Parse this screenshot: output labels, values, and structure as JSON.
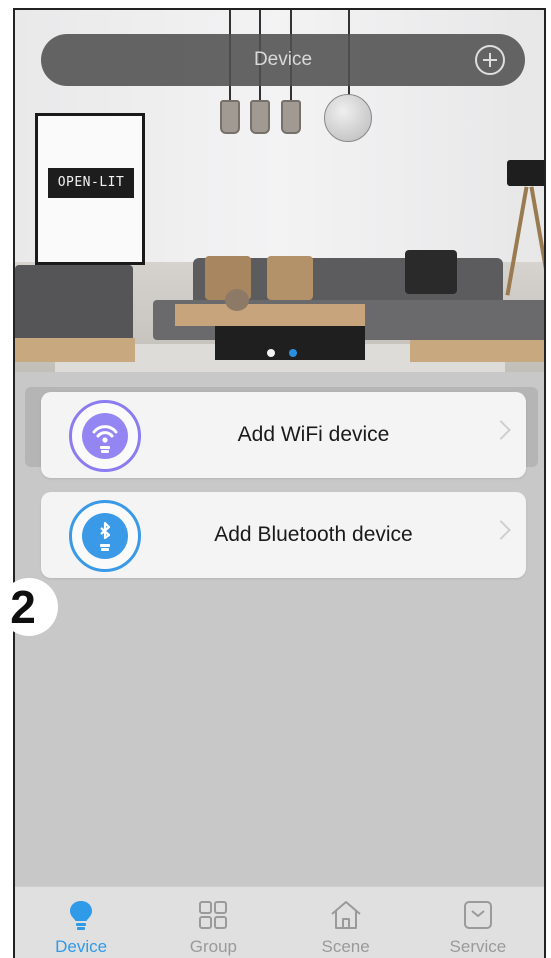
{
  "header": {
    "title": "Device",
    "add_icon": "plus-circle-icon"
  },
  "banner": {
    "sign_text": "OPEN-LIT",
    "page_count": 2,
    "active_page": 2
  },
  "actions": [
    {
      "label": "Add WiFi device",
      "icon": "wifi-bulb-icon",
      "color": "#8b7cf0"
    },
    {
      "label": "Add Bluetooth device",
      "icon": "bluetooth-bulb-icon",
      "color": "#3a9ae8"
    }
  ],
  "step_badge": "2",
  "tabs": [
    {
      "label": "Device",
      "icon": "bulb-icon",
      "active": true
    },
    {
      "label": "Group",
      "icon": "grid-icon",
      "active": false
    },
    {
      "label": "Scene",
      "icon": "home-icon",
      "active": false
    },
    {
      "label": "Service",
      "icon": "chat-icon",
      "active": false
    }
  ],
  "colors": {
    "accent": "#2e9ae8",
    "inactive": "#9a9a9a"
  }
}
